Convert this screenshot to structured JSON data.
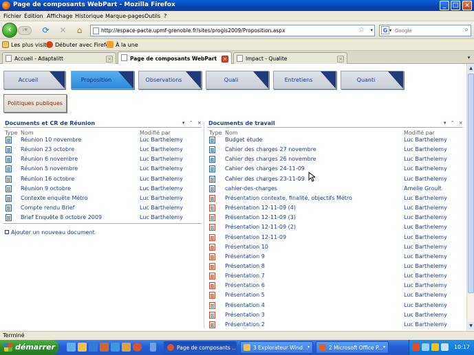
{
  "window": {
    "title": "Page de composants WebPart - Mozilla Firefox"
  },
  "menu": [
    "Fichier",
    "Édition",
    "Affichage",
    "Historique",
    "Marque-pages",
    "Outils",
    "?"
  ],
  "nav": {
    "url": "http://espace-pacte.upmf-grenoble.fr/sites/progis2009/Proposition.aspx",
    "search_placeholder": "Google",
    "search_engine_letter": "G"
  },
  "bookmarks": [
    "Les plus visités",
    "Débuter avec Firefox",
    "À la une"
  ],
  "tabs": [
    {
      "label": "Accueil - Adaptalitt",
      "active": false
    },
    {
      "label": "Page de composants WebPart",
      "active": true
    },
    {
      "label": "Impact - Qualite",
      "active": false
    }
  ],
  "site_nav": {
    "tiles": [
      "Accueil",
      "Proposition",
      "Observations",
      "Quali",
      "Entretiens",
      "Quanti"
    ],
    "active": "Proposition",
    "extra_tile": "Politiques publiques"
  },
  "left_part": {
    "title": "Documents et CR de Réunion",
    "col_type": "Type",
    "col_name": "Nom",
    "col_modified": "Modifié par",
    "rows": [
      {
        "name": "Réunion 10 novembre",
        "by": "Luc Barthelemy",
        "kind": "doc"
      },
      {
        "name": "Réunion 23 octobre",
        "by": "Luc Barthelemy",
        "kind": "doc"
      },
      {
        "name": "Réunion 6 novembre",
        "by": "Luc Barthelemy",
        "kind": "doc"
      },
      {
        "name": "Réunion 5 novembre",
        "by": "Luc Barthelemy",
        "kind": "doc"
      },
      {
        "name": "Réunion 16 octobre",
        "by": "Luc Barthelemy",
        "kind": "doc"
      },
      {
        "name": "Réunion 9 octobre",
        "by": "Luc Barthelemy",
        "kind": "doc"
      },
      {
        "name": "Contexte enquête Métro",
        "by": "Luc Barthelemy",
        "kind": "doc"
      },
      {
        "name": "Compte rendu Brief",
        "by": "Luc Barthelemy",
        "kind": "doc"
      },
      {
        "name": "Brief Enquête 8 octobre 2009",
        "by": "Luc Barthelemy",
        "kind": "doc"
      }
    ],
    "add_link": "Ajouter un nouveau document"
  },
  "right_part": {
    "title": "Documents de travail",
    "col_type": "Type",
    "col_name": "Nom",
    "col_modified": "Modifié par",
    "rows": [
      {
        "name": "Budget étude",
        "by": "Luc Barthelemy",
        "kind": "doc"
      },
      {
        "name": "Cahier des charges 27 novembre",
        "by": "Luc Barthelemy",
        "kind": "doc"
      },
      {
        "name": "Cahier des charges 26 novembre",
        "by": "Luc Barthelemy",
        "kind": "doc"
      },
      {
        "name": "Cahier des charges 24-11-09",
        "by": "Luc Barthelemy",
        "kind": "doc"
      },
      {
        "name": "Cahier des charges 23-11-09",
        "by": "Luc Barthelemy",
        "kind": "doc"
      },
      {
        "name": "cahier-des-charges",
        "by": "Amelie Groult",
        "kind": "doc"
      },
      {
        "name": "Présentation contexte, finalité, objectifs Métro",
        "by": "Luc Barthelemy",
        "kind": "ppt"
      },
      {
        "name": "Présentation 12-11-09 (4)",
        "by": "Luc Barthelemy",
        "kind": "ppt"
      },
      {
        "name": "Présentation 12-11-09 (3)",
        "by": "Luc Barthelemy",
        "kind": "ppt"
      },
      {
        "name": "Présentation 12-11-09 (2)",
        "by": "Luc Barthelemy",
        "kind": "ppt"
      },
      {
        "name": "Présentation 12-11-09",
        "by": "Luc Barthelemy",
        "kind": "ppt"
      },
      {
        "name": "Présentation 10",
        "by": "Luc Barthelemy",
        "kind": "ppt"
      },
      {
        "name": "Présentation 9",
        "by": "Luc Barthelemy",
        "kind": "ppt"
      },
      {
        "name": "Présentation 8",
        "by": "Luc Barthelemy",
        "kind": "ppt"
      },
      {
        "name": "Présentation 7",
        "by": "Luc Barthelemy",
        "kind": "ppt"
      },
      {
        "name": "Présentation 6",
        "by": "Luc Barthelemy",
        "kind": "ppt"
      },
      {
        "name": "Présentation 5",
        "by": "Luc Barthelemy",
        "kind": "ppt"
      },
      {
        "name": "Présentation 4",
        "by": "Luc Barthelemy",
        "kind": "ppt"
      },
      {
        "name": "Présentation 3",
        "by": "Luc Barthelemy",
        "kind": "ppt"
      },
      {
        "name": "Présentation 2",
        "by": "Luc Barthelemy",
        "kind": "ppt"
      }
    ]
  },
  "webpart_ctrl_glyphs": "▾ ⌃ ×",
  "status": "Terminé",
  "taskbar": {
    "start_label": "démarrer",
    "tasks": [
      {
        "label": "Page de composants ...",
        "active": true
      },
      {
        "label": "3 Explorateur Wind...",
        "active": false
      },
      {
        "label": "2 Microsoft Office P...",
        "active": false
      }
    ],
    "clock": "10:17"
  },
  "colors": {
    "link_blue": "#1c3f8c",
    "active_tile": "#2f88dc",
    "tile_corner": "#223a78",
    "xp_blue": "#2460d6"
  }
}
